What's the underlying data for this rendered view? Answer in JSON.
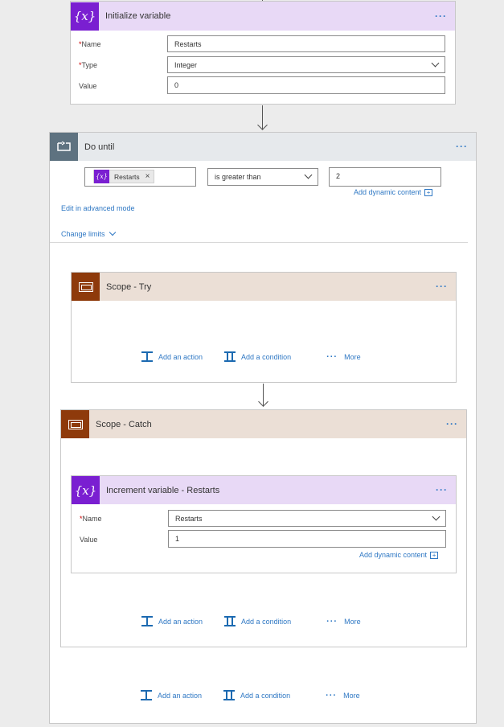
{
  "init_variable": {
    "title": "Initialize variable",
    "icon": "variable-icon",
    "name_label": "Name",
    "name_value": "Restarts",
    "type_label": "Type",
    "type_value": "Integer",
    "value_label": "Value",
    "value_value": "0",
    "required_mark": "*"
  },
  "do_until": {
    "title": "Do until",
    "token_label": "Restarts",
    "token_icon_text": "{x}",
    "token_remove": "×",
    "operator": "is greater than",
    "compare_value": "2",
    "add_dynamic_content": "Add dynamic content",
    "add_plus": "+",
    "edit_advanced": "Edit in advanced mode",
    "change_limits": "Change limits"
  },
  "scope_try": {
    "title": "Scope - Try",
    "add_action": "Add an action",
    "add_condition": "Add a condition",
    "more": "More"
  },
  "scope_catch": {
    "title": "Scope - Catch",
    "add_action": "Add an action",
    "add_condition": "Add a condition",
    "more": "More"
  },
  "increment_variable": {
    "title": "Increment variable - Restarts",
    "name_label": "Name",
    "name_value": "Restarts",
    "value_label": "Value",
    "value_value": "1",
    "add_dynamic_content": "Add dynamic content",
    "add_plus": "+",
    "required_mark": "*"
  },
  "loop_actions": {
    "add_action": "Add an action",
    "add_condition": "Add a condition",
    "more": "More"
  },
  "menu_dots": "···",
  "more_dots": "···",
  "var_icon_text": "{x}",
  "colors": {
    "variable": "#7a1fd1",
    "variable_header": "#e8d9f6",
    "scope": "#8e3a0b",
    "scope_header": "#ebdfd6",
    "loop": "#5e7280",
    "loop_header": "#e6e9ec",
    "link": "#2f78c4"
  }
}
